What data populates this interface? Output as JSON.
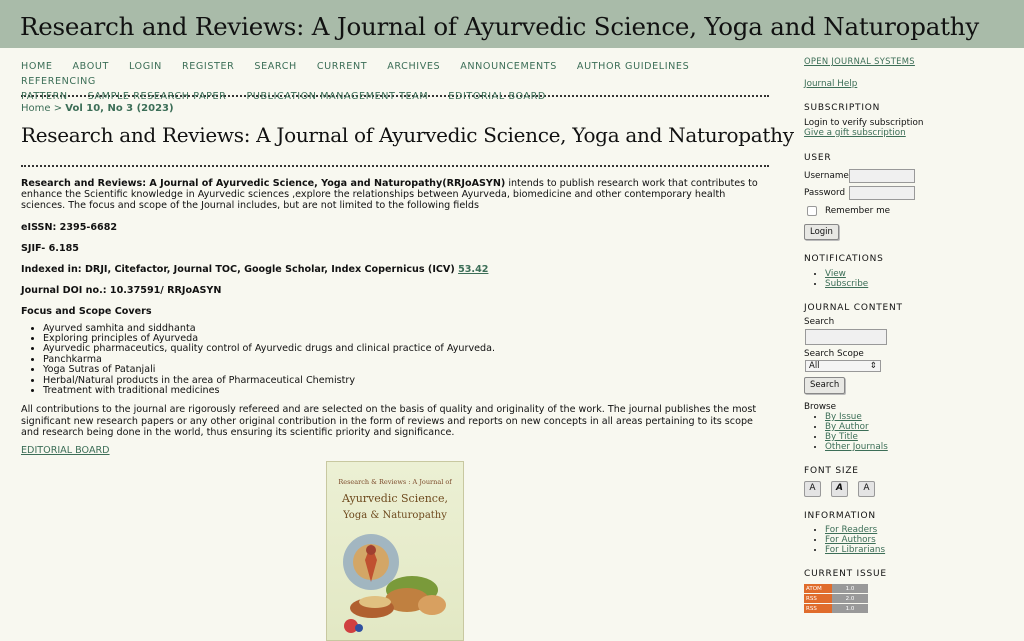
{
  "header": {
    "title": "Research and Reviews: A Journal of Ayurvedic Science, Yoga and Naturopathy"
  },
  "nav": [
    {
      "label": "HOME"
    },
    {
      "label": "ABOUT"
    },
    {
      "label": "LOGIN"
    },
    {
      "label": "REGISTER"
    },
    {
      "label": "SEARCH"
    },
    {
      "label": "CURRENT"
    },
    {
      "label": "ARCHIVES"
    },
    {
      "label": "ANNOUNCEMENTS"
    },
    {
      "label": "AUTHOR GUIDELINES"
    },
    {
      "label": "REFERENCING"
    },
    {
      "label": "PATTERN"
    },
    {
      "label": "SAMPLE RESEARCH PAPER"
    },
    {
      "label": "PUBLICATION MANAGEMENT TEAM"
    },
    {
      "label": "EDITORIAL BOARD"
    }
  ],
  "breadcrumb": {
    "home": "Home",
    "sep": " > ",
    "current": "Vol 10, No 3 (2023)"
  },
  "page_title": "Research and Reviews: A Journal of Ayurvedic Science, Yoga and Naturopathy",
  "intro": {
    "bold": "Research and Reviews: A Journal of Ayurvedic Science, Yoga and Naturopathy(RRJoASYN)",
    "text": " intends to publish research work that contributes to enhance the Scientific knowledge in Ayurvedic sciences ,explore the relationships between Ayurveda, biomedicine and other contemporary health sciences. The focus and scope of the Journal includes, but are not limited to the following fields"
  },
  "eissn": "eISSN: 2395-6682",
  "sjif": "SJIF- 6.185",
  "indexed": {
    "text": "Indexed in: DRJI, Citefactor, Journal TOC, Google Scholar, Index Copernicus (ICV) ",
    "link": "53.42"
  },
  "doi": "Journal DOI no.: 10.37591/ RRJoASYN",
  "focus_heading": "Focus and Scope Covers",
  "focus_items": [
    "Ayurved samhita and siddhanta",
    "Exploring principles of Ayurveda",
    "Ayurvedic pharmaceutics, quality control of Ayurvedic drugs and clinical practice of Ayurveda.",
    "Panchkarma",
    "Yoga Sutras of Patanjali",
    "Herbal/Natural products in the area of Pharmaceutical Chemistry",
    "Treatment with traditional medicines"
  ],
  "closing": "All contributions to the journal are rigorously refereed and are selected on the basis of quality and originality of the work. The journal publishes the most significant new research papers or any other original contribution in the form of reviews and reports on new concepts in all areas pertaining to its scope and research being done in the world, thus ensuring its scientific priority and significance.",
  "editorial_link": "EDITORIAL BOARD",
  "cover": {
    "line1": "Research & Reviews : A Journal of",
    "line2": "Ayurvedic Science,",
    "line3": "Yoga & Naturopathy"
  },
  "sidebar": {
    "ojs": "OPEN JOURNAL SYSTEMS",
    "help": "Journal Help",
    "subscription": {
      "heading": "SUBSCRIPTION",
      "text": "Login to verify subscription",
      "link": "Give a gift subscription"
    },
    "user": {
      "heading": "USER",
      "username": "Username",
      "password": "Password",
      "remember": "Remember me",
      "login": "Login"
    },
    "notifications": {
      "heading": "NOTIFICATIONS",
      "items": [
        "View",
        "Subscribe"
      ]
    },
    "journal_content": {
      "heading": "JOURNAL CONTENT",
      "search_label": "Search",
      "scope_label": "Search Scope",
      "scope_value": "All",
      "search_btn": "Search",
      "browse": "Browse",
      "browse_items": [
        "By Issue",
        "By Author",
        "By Title",
        "Other Journals"
      ]
    },
    "font_size": {
      "heading": "FONT SIZE"
    },
    "information": {
      "heading": "INFORMATION",
      "items": [
        "For Readers",
        "For Authors",
        "For Librarians"
      ]
    },
    "current_issue": {
      "heading": "CURRENT ISSUE",
      "feeds": [
        {
          "l": "ATOM",
          "r": "1.0"
        },
        {
          "l": "RSS",
          "r": "2.0"
        },
        {
          "l": "RSS",
          "r": "1.0"
        }
      ]
    }
  }
}
